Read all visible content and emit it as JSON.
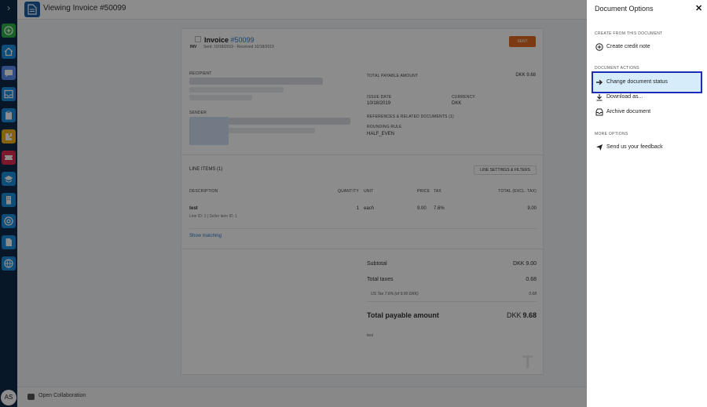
{
  "rail": {
    "expand_icon": "chevron-right-icon",
    "apps": [
      {
        "name": "add-app-icon",
        "color": "#2db34a"
      },
      {
        "name": "home-app-icon",
        "color": "#1b8fe0"
      },
      {
        "name": "chat-app-icon",
        "color": "#5b8ef0"
      },
      {
        "name": "inbox-app-icon",
        "color": "#1b8fe0"
      },
      {
        "name": "clipboard-app-icon",
        "color": "#1b8fe0"
      },
      {
        "name": "puzzle-app-icon",
        "color": "#f3b417"
      },
      {
        "name": "ticket-app-icon",
        "color": "#e42a4f"
      },
      {
        "name": "education-app-icon",
        "color": "#1b8fe0"
      },
      {
        "name": "building-app-icon",
        "color": "#1b8fe0"
      },
      {
        "name": "support-app-icon",
        "color": "#1b8fe0"
      },
      {
        "name": "document-app-icon",
        "color": "#1b8fe0"
      },
      {
        "name": "globe-app-icon",
        "color": "#1b8fe0"
      }
    ],
    "avatar_initials": "AS"
  },
  "header": {
    "title": "Viewing Invoice #50099"
  },
  "invoice": {
    "title_prefix": "Invoice",
    "number": "#50099",
    "badge": "INV",
    "sub": "Sent: 10/18/2019 - Received 10/18/2019",
    "status_button": "SENT",
    "recipient_label": "RECIPIENT",
    "sender_label": "SENDER",
    "total_payable_label": "TOTAL PAYABLE AMOUNT",
    "total_payable_value": "DKK 9.68",
    "issue_date_label": "ISSUE DATE",
    "issue_date_value": "10/18/2019",
    "currency_label": "CURRENCY",
    "currency_value": "DKK",
    "references_label": "REFERENCES & RELATED DOCUMENTS",
    "references_count": "(1)",
    "rounding_label": "ROUNDING RULE",
    "rounding_value": "HALF_EVEN",
    "line_items_label": "LINE ITEMS",
    "line_items_count": "(1)",
    "line_settings_button": "LINE SETTINGS & FILTERS",
    "columns": {
      "description": "DESCRIPTION",
      "quantity": "QUANTITY",
      "unit": "UNIT",
      "price": "PRICE",
      "tax": "TAX",
      "total": "TOTAL (EXCL. TAX)"
    },
    "line": {
      "description": "test",
      "ids": "Line ID: 1 | Seller item ID: 1",
      "quantity": "1",
      "unit": "each",
      "price": "9.00",
      "tax": "7.6%",
      "total": "9.00"
    },
    "show_matching": "Show matching",
    "subtotal_label": "Subtotal",
    "subtotal_value": "DKK 9.00",
    "total_taxes_label": "Total taxes",
    "total_taxes_value": "0.68",
    "tax_detail_label": "US Tax 7.6% (of 9.00 DKK)",
    "tax_detail_value": "0.68",
    "total_label": "Total payable amount",
    "total_currency": "DKK",
    "total_value": "9.68",
    "footer_note": "test"
  },
  "bottom": {
    "collaboration": "Open Collaboration"
  },
  "panel": {
    "title": "Document Options",
    "close_icon": "close-icon",
    "sections": {
      "create": "CREATE FROM THIS DOCUMENT",
      "actions": "DOCUMENT ACTIONS",
      "more": "MORE OPTIONS"
    },
    "items": {
      "credit_note": "Create credit note",
      "change_status": "Change document status",
      "download": "Download as...",
      "archive": "Archive document",
      "feedback": "Send us your feedback"
    }
  }
}
